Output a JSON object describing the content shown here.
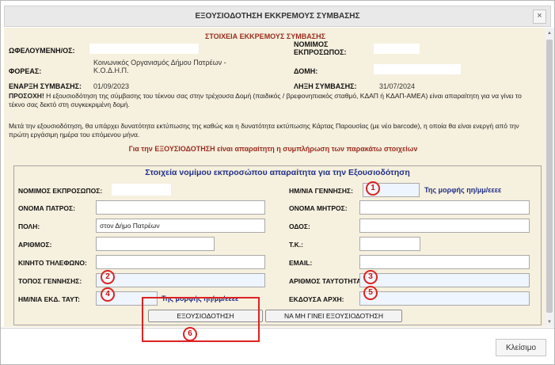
{
  "dialog": {
    "title": "ΕΞΟΥΣΙΟΔΟΤΗΣΗ ΕΚΚΡΕΜΟΥΣ ΣΥΜΒΑΣΗΣ",
    "close_glyph": "×"
  },
  "section": {
    "heading": "ΣΤΟΙΧΕΙΑ ΕΚΚΡΕΜΟΥΣ ΣΥΜΒΑΣΗΣ",
    "beneficiary_label": "ΩΦΕΛΟΥΜΕΝΗ/ΟΣ:",
    "legal_rep_label": "ΝΟΜΙΜΟΣ ΕΚΠΡΟΣΩΠΟΣ:",
    "body_label": "ΦΟΡΕΑΣ:",
    "body_value": "Κοινωνικός Οργανισμός Δήμου Πατρέων - Κ.Ο.Δ.Η.Π.",
    "structure_label": "ΔΟΜΗ:",
    "start_label": "ΕΝΑΡΞΗ ΣΥΜΒΑΣΗΣ:",
    "start_value": "01/09/2023",
    "end_label": "ΛΗΞΗ ΣΥΜΒΑΣΗΣ:",
    "end_value": "31/07/2024"
  },
  "notice": {
    "attention_label": "ΠΡΟΣΟΧΗ!",
    "attention_text": " Η εξουσιοδότηση της σύμβασης του τέκνου σας στην τρέχουσα Δομή (παιδικός / βρεφονηπιακός σταθμό, ΚΔΑΠ ή ΚΔΑΠ-ΑΜΕΑ) είναι απαραίτητη για να γίνει το τέκνο σας δεκτό στη συγκεκριμένη δομή.",
    "info_text": "Μετά την εξουσιοδότηση, θα υπάρχει δυνατότητα εκτύπωσης της καθώς και η δυνατότητα εκτύπωσης Κάρτας Παρουσίας (με νέο barcode), η οποία θα είναι ενεργή από την πρώτη εργάσιμη ημέρα του επόμενου μήνα.",
    "required_heading": "Για την ΕΞΟΥΣΙΟΔΟΤΗΣΗ είναι απαραίτητη η συμπλήρωση των παρακάτω στοιχείων"
  },
  "form": {
    "title": "Στοιχεία νομίμου εκπροσώπου απαραίτητα για την Εξουσιοδότηση",
    "legal_rep_label": "ΝΟΜΙΜΟΣ ΕΚΠΡΟΣΩΠΟΣ:",
    "birthdate_label": "ΗΜ/ΝΙΑ ΓΕΝΝΗΣΗΣ:",
    "birthdate_hint": "Της μορφής ηη/μμ/εεεε",
    "father_label": "ΟΝΟΜΑ ΠΑΤΡΟΣ:",
    "mother_label": "ΟΝΟΜΑ ΜΗΤΡΟΣ:",
    "city_label": "ΠΟΛΗ:",
    "city_value": "στον Δήμο Πατρέων",
    "street_label": "ΟΔΟΣ:",
    "number_label": "ΑΡΙΘΜΟΣ:",
    "postal_label": "Τ.Κ.:",
    "mobile_label": "ΚΙΝΗΤΟ ΤΗΛΕΦΩΝΟ:",
    "email_label": "EMAIL:",
    "birthplace_label": "ΤΟΠΟΣ ΓΕΝΝΗΣΗΣ:",
    "id_number_label": "ΑΡΙΘΜΟΣ ΤΑΥΤΟΤΗΤΑΣ:",
    "id_date_label": "ΗΜ/ΝΙΑ ΕΚΔ. ΤΑΥΤ:",
    "id_date_hint": "Της μορφής ηη/μμ/εεεε",
    "issuer_label": "ΕΚΔΟΥΣΑ ΑΡΧΗ:"
  },
  "buttons": {
    "authorize": "ΕΞΟΥΣΙΟΔΟΤΗΣΗ",
    "reject": "ΝΑ ΜΗ ΓΙΝΕΙ ΕΞΟΥΣΙΟΔΟΤΗΣΗ",
    "close": "Κλείσιμο"
  },
  "markers": [
    "1",
    "2",
    "3",
    "4",
    "5",
    "6"
  ]
}
